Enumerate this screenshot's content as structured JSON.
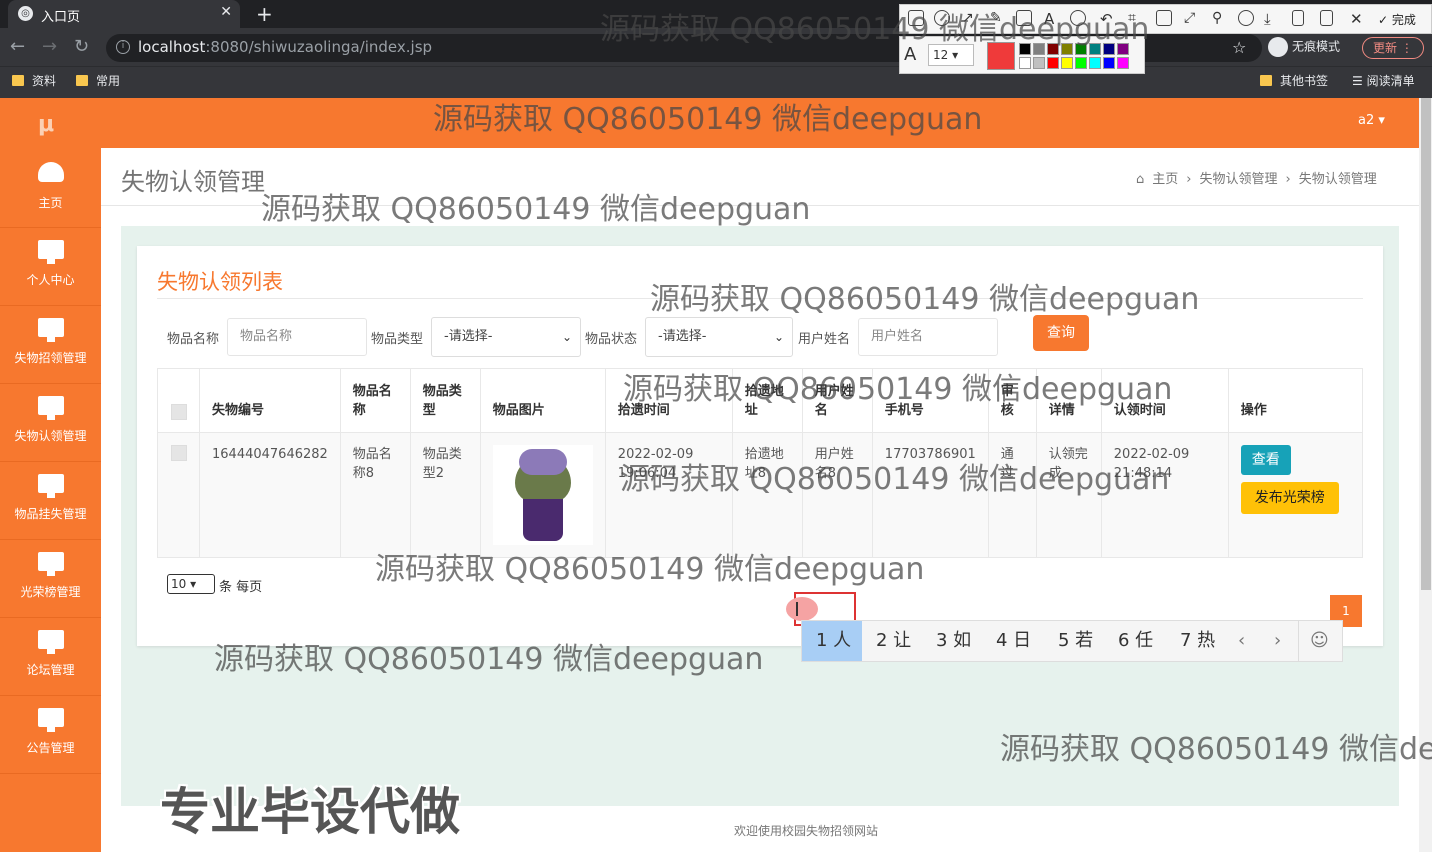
{
  "browser": {
    "tab_title": "入口页",
    "tab_close": "✕",
    "new_tab": "+",
    "url_host": "localhost",
    "url_rest": ":8080/shiwuzaolinga/index.jsp",
    "incognito": "无痕模式",
    "update": "更新",
    "bookmarks": [
      "资料",
      "常用"
    ],
    "other_bookmarks": "其他书签",
    "reading_list": "阅读清单"
  },
  "screenshot_tool": {
    "font_size": "12",
    "done": "完成",
    "colors": [
      "#000000",
      "#808080",
      "#800000",
      "#808000",
      "#008000",
      "#008080",
      "#000080",
      "#800080",
      "#ffffff",
      "#c0c0c0",
      "#ff0000",
      "#ffff00",
      "#00ff00",
      "#00ffff",
      "#0000ff",
      "#ff00ff"
    ],
    "active_color": "#ef3a3a"
  },
  "app": {
    "accent": "#f7782f",
    "logo": "μ",
    "user": "a2 ▾",
    "menu": [
      "主页",
      "个人中心",
      "失物招领管理",
      "失物认领管理",
      "物品挂失管理",
      "光荣榜管理",
      "论坛管理",
      "公告管理"
    ],
    "page_title": "失物认领管理",
    "breadcrumb": [
      "主页",
      "失物认领管理",
      "失物认领管理"
    ],
    "breadcrumb_sep": "›",
    "card_title": "失物认领列表",
    "filters": {
      "name_label": "物品名称",
      "name_placeholder": "物品名称",
      "type_label": "物品类型",
      "type_value": "-请选择-",
      "status_label": "物品状态",
      "status_value": "-请选择-",
      "user_label": "用户姓名",
      "user_placeholder": "用户姓名",
      "query": "查询"
    },
    "table": {
      "headers": [
        "失物编号",
        "物品名称",
        "物品类型",
        "物品图片",
        "拾遗时间",
        "拾遗地址",
        "用户姓名",
        "手机号",
        "审核",
        "详情",
        "认领时间",
        "操作"
      ],
      "rows": [
        {
          "id": "16444047646282",
          "name": "物品名称8",
          "type": "物品类型2",
          "found_time": "2022-02-09 19:06:04",
          "address": "拾遗地址8",
          "username": "用户姓名8",
          "phone": "17703786901",
          "audit": "通过",
          "detail": "认领完成",
          "claim_time": "2022-02-09 21:48:14",
          "btn_view": "查看",
          "btn_publish": "发布光荣榜"
        }
      ]
    },
    "pagination": {
      "per_page": "10",
      "per_page_suffix": "条 每页",
      "page": "1"
    },
    "footer": "欢迎使用校园失物招领网站"
  },
  "ime": {
    "candidates": [
      "1 人",
      "2 让",
      "3 如",
      "4 日",
      "5 若",
      "6 任",
      "7 热"
    ],
    "prev": "‹",
    "next": "›",
    "emoji": "☺"
  },
  "overlay": {
    "watermark": "源码获取 QQ86050149 微信deepguan",
    "promo": "专业毕设代做"
  }
}
